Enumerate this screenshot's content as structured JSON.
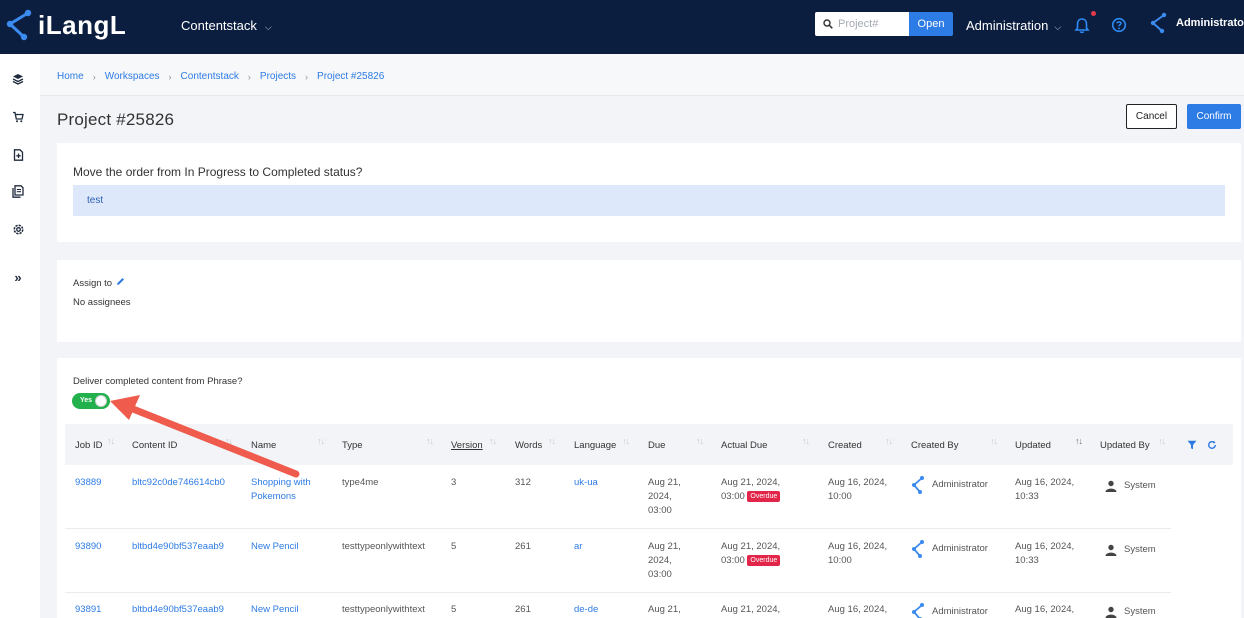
{
  "app": {
    "logo_text": "iLangL",
    "workspace": "Contentstack"
  },
  "search": {
    "placeholder": "Project#",
    "open_label": "Open"
  },
  "admin_menu": {
    "label": "Administration"
  },
  "user": {
    "name": "Administrator"
  },
  "breadcrumb": [
    "Home",
    "Workspaces",
    "Contentstack",
    "Projects",
    "Project #25826"
  ],
  "page": {
    "title": "Project #25826",
    "cancel_label": "Cancel",
    "confirm_label": "Confirm"
  },
  "status_card": {
    "question": "Move the order from In Progress to Completed status?",
    "note": "test"
  },
  "assign_card": {
    "label": "Assign to",
    "value": "No assignees"
  },
  "deliver_card": {
    "label": "Deliver completed content from Phrase?",
    "toggle_label": "Yes",
    "toggle_on": true
  },
  "table": {
    "headers": [
      "Job ID",
      "Content ID",
      "Name",
      "Type",
      "Version",
      "Words",
      "Language",
      "Due",
      "Actual Due",
      "Created",
      "Created By",
      "Updated",
      "Updated By"
    ],
    "rows": [
      {
        "job_id": "93889",
        "content_id": "bltc92c0de746614cb0",
        "name": "Shopping with Pokemons",
        "type": "type4me",
        "version": "3",
        "words": "312",
        "language": "uk-ua",
        "due": "Aug 21, 2024, 03:00",
        "actual_due": "Aug 21, 2024, 03:00",
        "overdue_label": "Overdue",
        "created": "Aug 16, 2024, 10:00",
        "created_by": "Administrator",
        "updated": "Aug 16, 2024, 10:33",
        "updated_by": "System"
      },
      {
        "job_id": "93890",
        "content_id": "bltbd4e90bf537eaab9",
        "name": "New Pencil",
        "type": "testtypeonlywithtext",
        "version": "5",
        "words": "261",
        "language": "ar",
        "due": "Aug 21, 2024, 03:00",
        "actual_due": "Aug 21, 2024, 03:00",
        "overdue_label": "Overdue",
        "created": "Aug 16, 2024, 10:00",
        "created_by": "Administrator",
        "updated": "Aug 16, 2024, 10:33",
        "updated_by": "System"
      },
      {
        "job_id": "93891",
        "content_id": "bltbd4e90bf537eaab9",
        "name": "New Pencil",
        "type": "testtypeonlywithtext",
        "version": "5",
        "words": "261",
        "language": "de-de",
        "due": "Aug 21,",
        "actual_due": "Aug 21, 2024,",
        "created": "Aug 16, 2024,",
        "created_by": "Administrator",
        "updated": "Aug 16, 2024,",
        "updated_by": "System"
      }
    ]
  },
  "colors": {
    "topbar": "#0c1e3f",
    "accent": "#2d7be5",
    "toggle_on": "#22b14c",
    "overdue": "#e2264a",
    "annotation_arrow": "#ef5b4c"
  },
  "icons": {
    "sidebar": [
      "layers-icon",
      "cart-icon",
      "add-document-icon",
      "documents-icon",
      "gear-icon",
      "expand-icon"
    ]
  }
}
